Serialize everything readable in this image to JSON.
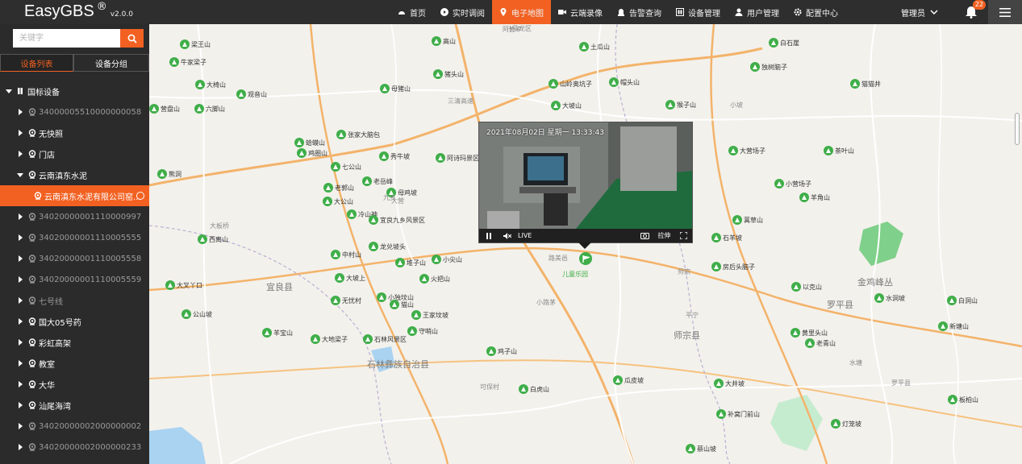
{
  "brand": {
    "name": "EasyGBS",
    "reg": "®",
    "version": "v2.0.0"
  },
  "nav": [
    {
      "label": "首页",
      "icon": "dashboard-icon"
    },
    {
      "label": "实时调阅",
      "icon": "play-icon"
    },
    {
      "label": "电子地图",
      "icon": "map-pin-icon",
      "active": true
    },
    {
      "label": "云端录像",
      "icon": "video-camera-icon"
    },
    {
      "label": "告警查询",
      "icon": "alarm-icon"
    },
    {
      "label": "设备管理",
      "icon": "device-icon"
    },
    {
      "label": "用户管理",
      "icon": "user-icon"
    },
    {
      "label": "配置中心",
      "icon": "gear-icon"
    }
  ],
  "user": {
    "label": "管理员"
  },
  "notifications": {
    "count": "22"
  },
  "colors": {
    "accent": "#f26122",
    "poi": "#3fae49",
    "topbar": "#2e2e2e",
    "sidebar": "#2b2b2b"
  },
  "sidebar": {
    "search_placeholder": "关键字",
    "tabs": {
      "device_list": "设备列表",
      "device_group": "设备分组"
    },
    "root": "国标设备",
    "items": [
      {
        "label": "34000005510000000058",
        "muted": true
      },
      {
        "label": "无快照"
      },
      {
        "label": "门店"
      },
      {
        "label": "云南滇东水泥",
        "expanded": true
      },
      {
        "label": "云南滇东水泥有限公司窑...",
        "selected": true
      },
      {
        "label": "34020000001110000997",
        "muted": true
      },
      {
        "label": "34020000001110005555",
        "muted": true
      },
      {
        "label": "34020000001110005558",
        "muted": true
      },
      {
        "label": "34020000001110005559",
        "muted": true
      },
      {
        "label": "七号线",
        "muted": true
      },
      {
        "label": "国大05号药"
      },
      {
        "label": "彩虹高架"
      },
      {
        "label": "教室"
      },
      {
        "label": "大华"
      },
      {
        "label": "汕尾海湾"
      },
      {
        "label": "34020000002000000002",
        "muted": true
      },
      {
        "label": "34020000002000000233",
        "muted": true
      }
    ]
  },
  "video": {
    "timestamp": "2021年08月02日 星期一 13:33:43",
    "live_label": "LIVE",
    "stretch_label": "拉伸"
  },
  "map": {
    "marker_label": "儿童乐园",
    "cities": [
      "师宗县",
      "石林彝族自治县",
      "罗平县",
      "宜良县",
      "金鸡峰丛"
    ],
    "pois": [
      "梁王山",
      "牛家梁子",
      "大椅山",
      "观音山",
      "营盘山",
      "六脚山",
      "张家大脑包",
      "蛤蟆山",
      "鸡圈山",
      "七公山",
      "熊洞",
      "老岳峰",
      "老郭山",
      "土瓜山",
      "帽头山",
      "山岭奥坑子",
      "大坡山",
      "猪头山",
      "高山",
      "母猪山",
      "秀牛坡",
      "母鸡坡",
      "猴子山",
      "阿诗玛景区",
      "白石崖",
      "独树脑子",
      "大营场子",
      "茶叶山",
      "小营场子",
      "羊角山",
      "石羊坡",
      "房后头脑子",
      "蒿草山",
      "猫猫井",
      "大公山",
      "冷山神",
      "宜良九乡风景区",
      "龙兑坡头",
      "中村山",
      "堆子山",
      "小尖山",
      "火把山",
      "西离山",
      "大坡上",
      "大叉丫口",
      "无忧村",
      "小独坟山",
      "猫山",
      "公山坡",
      "羊宝山",
      "石林风景区",
      "大地梁子",
      "王家坟坡",
      "守哨山",
      "鸡子山",
      "白虎山",
      "瓜皮坡",
      "大井坡",
      "补窝门前山",
      "蔡山坡",
      "老青山",
      "以克山",
      "水洞坡",
      "白洞山",
      "新塘山",
      "黄里头山",
      "灯笼坡",
      "板柏山"
    ],
    "places": [
      "马龙区",
      "阿竹",
      "长冲",
      "三清高速",
      "九乡",
      "大营",
      "可保村",
      "小路茅",
      "路美邑",
      "小坡",
      "师宗",
      "平宁",
      "大板桥",
      "水塘",
      "罗平县"
    ]
  }
}
